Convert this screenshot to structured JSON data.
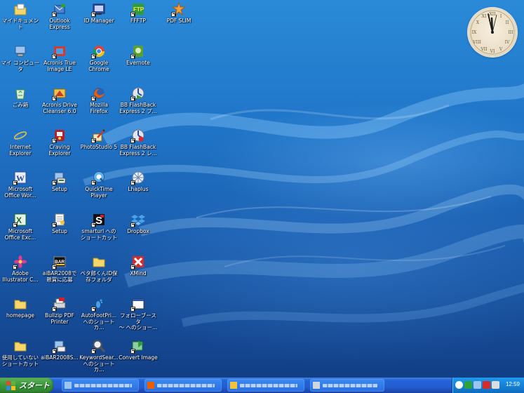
{
  "desktop": {
    "icons": [
      {
        "label": "マイドキュメント",
        "icon": "my-documents-folder-icon"
      },
      {
        "label": "Outlook\nExpress",
        "icon": "outlook-express-icon"
      },
      {
        "label": "ID Manager",
        "icon": "id-manager-icon"
      },
      {
        "label": "FFFTP",
        "icon": "ffftp-icon"
      },
      {
        "label": "PDF SLIM",
        "icon": "pdf-slim-icon"
      },
      {
        "label": "マイ コンピュータ",
        "icon": "my-computer-icon"
      },
      {
        "label": "Acronis True\nImage LE",
        "icon": "acronis-true-image-icon"
      },
      {
        "label": "Google\nChrome",
        "icon": "google-chrome-icon"
      },
      {
        "label": "Evernote",
        "icon": "evernote-icon"
      },
      {
        "label": "ごみ箱",
        "icon": "recycle-bin-icon"
      },
      {
        "label": "Acronis Drive\nCleanser 6.0",
        "icon": "acronis-drive-cleanser-icon"
      },
      {
        "label": "Mozilla\nFirefox",
        "icon": "firefox-icon"
      },
      {
        "label": "BB FlashBack\nExpress 2 プ...",
        "icon": "bb-flashback-player-icon"
      },
      {
        "label": "Internet\nExplorer",
        "icon": "internet-explorer-icon"
      },
      {
        "label": "Craving\nExplorer",
        "icon": "craving-explorer-icon"
      },
      {
        "label": "PhotoStudio 5",
        "icon": "photostudio-icon"
      },
      {
        "label": "BB FlashBack\nExpress 2 レ...",
        "icon": "bb-flashback-recorder-icon"
      },
      {
        "label": "Microsoft\nOffice Wor...",
        "icon": "word-icon"
      },
      {
        "label": "Setup",
        "icon": "setup-icon"
      },
      {
        "label": "QuickTime\nPlayer",
        "icon": "quicktime-icon"
      },
      {
        "label": "Lhaplus",
        "icon": "lhaplus-icon"
      },
      {
        "label": "Microsoft\nOffice Exc...",
        "icon": "excel-icon"
      },
      {
        "label": "Setup",
        "icon": "setup-document-icon"
      },
      {
        "label": "smarturl への\nショートカット",
        "icon": "smarturl-icon"
      },
      {
        "label": "Dropbox",
        "icon": "dropbox-icon"
      },
      {
        "label": "Adobe\nIllustrator C...",
        "icon": "illustrator-icon"
      },
      {
        "label": "aiBAR2008で\n懸賞に応募",
        "icon": "aibar-icon"
      },
      {
        "label": "ペタ郎くんID保\n存フォルダ",
        "icon": "folder-icon"
      },
      {
        "label": "XMind",
        "icon": "xmind-icon"
      },
      {
        "label": "homepage",
        "icon": "homepage-folder-icon"
      },
      {
        "label": "Bullzip PDF\nPrinter",
        "icon": "bullzip-pdf-printer-icon"
      },
      {
        "label": "AutoFootPri...\nへのショートカ...",
        "icon": "autofootprint-icon"
      },
      {
        "label": "フォローブースタ\n～ へのショー...",
        "icon": "follow-booster-icon"
      },
      {
        "label": "使用していない\nショートカット",
        "icon": "unused-shortcuts-folder-icon"
      },
      {
        "label": "aiBAR2008S...",
        "icon": "aibar-setup-icon"
      },
      {
        "label": "KeywordSear...\nへのショートカ...",
        "icon": "keyword-search-icon"
      },
      {
        "label": "Convert Image",
        "icon": "convert-image-icon"
      }
    ]
  },
  "taskbar": {
    "start_label": "スタート",
    "clock_time": "12:59"
  },
  "colors": {
    "desktop_top": "#2a8ad8",
    "desktop_bottom": "#123f86",
    "taskbar": "#245dd1",
    "start_green": "#3c9a3c",
    "tray": "#1583d6"
  }
}
